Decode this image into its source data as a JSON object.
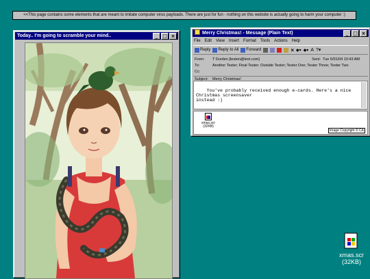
{
  "banner": "<<This page contains some elements that are meant to imitate computer virus payloads. There are just for fun - nothing on this website is actually going to harm your computer :)",
  "left_window": {
    "title": "Today.. I'm going to scramble your mind.."
  },
  "email_window": {
    "title": "Merry Christmas! - Message (Plain Text)",
    "menu": [
      "File",
      "Edit",
      "View",
      "Insert",
      "Format",
      "Tools",
      "Actions",
      "Help"
    ],
    "toolbar": [
      "Reply",
      "Reply to All",
      "Forward"
    ],
    "from_label": "From:",
    "from": "T Durden [testen@test.com]",
    "sent_label": "Sent:",
    "sent": "Tue 6/01/04 10:43 AM",
    "to_label": "To:",
    "to": "Another Tester; Final Tester; Outside Tester; Tester One; Tester Three; Tester Two",
    "cc_label": "Cc:",
    "cc": "",
    "subject_label": "Subject:",
    "subject": "Merry Christmas!",
    "body": "You've probably received enough e-cards. Here's a nice\nChristmas screensaver\ninstead :)",
    "attachment_name": "xmas.scr",
    "attachment_size": "(32KB)",
    "image_copyright": "Image Copyright © CA"
  },
  "desktop_icon": {
    "name": "xmas.scr",
    "size": "(32KB)"
  },
  "colors": {
    "desktop": "#008080",
    "titlebar": "#000080",
    "window": "#c0c0c0"
  }
}
